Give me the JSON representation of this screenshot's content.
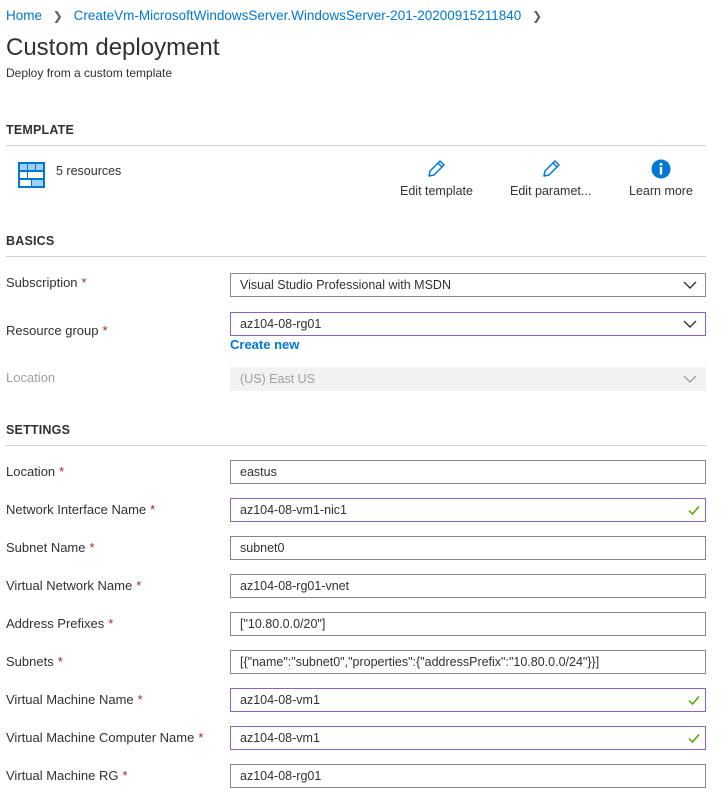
{
  "breadcrumb": {
    "home": "Home",
    "deployment": "CreateVm-MicrosoftWindowsServer.WindowsServer-201-20200915211840"
  },
  "header": {
    "title": "Custom deployment",
    "subtitle": "Deploy from a custom template"
  },
  "template": {
    "section_title": "TEMPLATE",
    "resources": "5 resources",
    "actions": {
      "edit_template": "Edit template",
      "edit_parameters": "Edit paramet...",
      "learn_more": "Learn more"
    }
  },
  "basics": {
    "section_title": "BASICS",
    "subscription": {
      "label": "Subscription",
      "value": "Visual Studio Professional with MSDN"
    },
    "resource_group": {
      "label": "Resource group",
      "value": "az104-08-rg01",
      "create_new": "Create new"
    },
    "location": {
      "label": "Location",
      "value": "(US) East US"
    }
  },
  "settings": {
    "section_title": "SETTINGS",
    "location": {
      "label": "Location",
      "value": "eastus"
    },
    "nic_name": {
      "label": "Network Interface Name",
      "value": "az104-08-vm1-nic1"
    },
    "subnet_name": {
      "label": "Subnet Name",
      "value": "subnet0"
    },
    "vnet_name": {
      "label": "Virtual Network Name",
      "value": "az104-08-rg01-vnet"
    },
    "address_prefixes": {
      "label": "Address Prefixes",
      "value": "[\"10.80.0.0/20\"]"
    },
    "subnets": {
      "label": "Subnets",
      "value": "[{\"name\":\"subnet0\",\"properties\":{\"addressPrefix\":\"10.80.0.0/24\"}}]"
    },
    "vm_name": {
      "label": "Virtual Machine Name",
      "value": "az104-08-vm1"
    },
    "vm_computer_name": {
      "label": "Virtual Machine Computer Name",
      "value": "az104-08-vm1"
    },
    "vm_rg": {
      "label": "Virtual Machine RG",
      "value": "az104-08-rg01"
    }
  },
  "required_marker": "*",
  "colors": {
    "link": "#0078d4",
    "required": "#a4262c",
    "valid_border": "#8764b8",
    "valid_check": "#57a300",
    "icon_blue": "#0078d4"
  },
  "icons": {
    "resources": "resources-grid-icon",
    "edit": "pencil-icon",
    "info": "info-icon",
    "dropdown": "chevron-down-icon",
    "valid": "checkmark-icon",
    "breadcrumb_separator": "chevron-right-icon"
  }
}
